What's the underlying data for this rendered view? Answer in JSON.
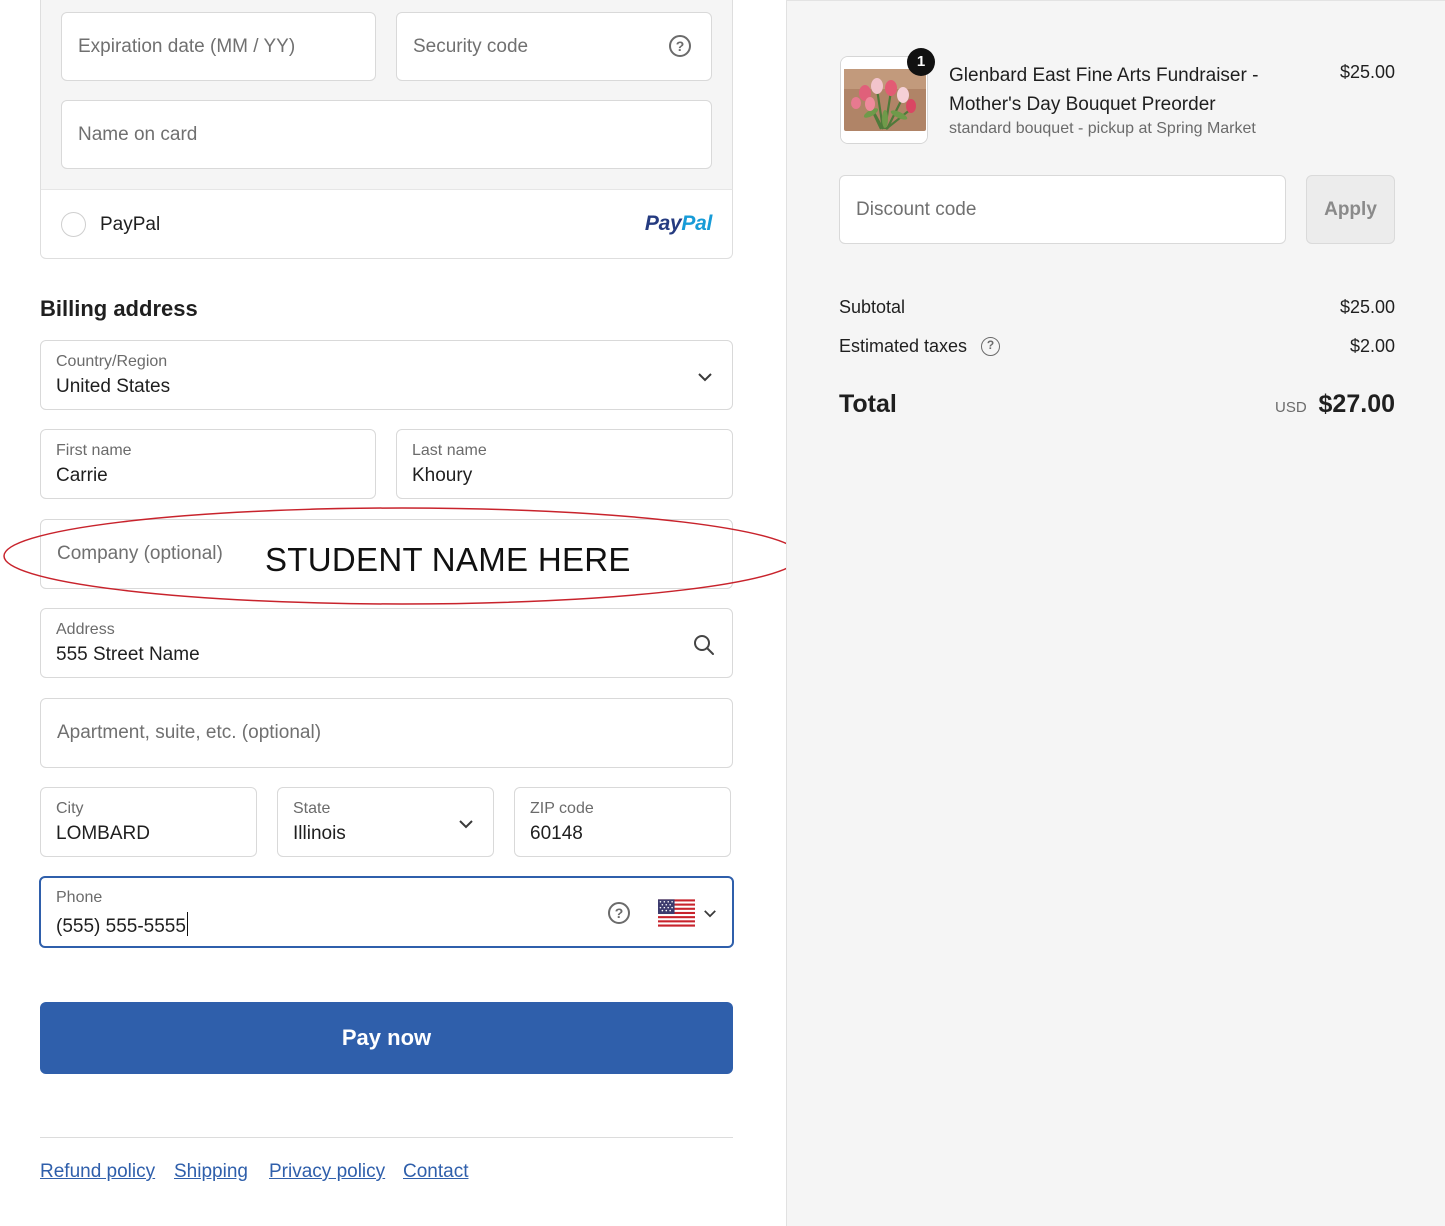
{
  "payment": {
    "expiration_placeholder": "Expiration date (MM / YY)",
    "security_placeholder": "Security code",
    "name_on_card_placeholder": "Name on card",
    "paypal_label": "PayPal",
    "paypal_logo_part1": "Pay",
    "paypal_logo_part2": "Pal"
  },
  "billing": {
    "title": "Billing address",
    "country_label": "Country/Region",
    "country_value": "United States",
    "first_name_label": "First name",
    "first_name_value": "Carrie",
    "last_name_label": "Last name",
    "last_name_value": "Khoury",
    "company_placeholder": "Company (optional)",
    "company_annotation": "STUDENT NAME HERE",
    "address_label": "Address",
    "address_value": "555 Street Name",
    "apartment_placeholder": "Apartment, suite, etc. (optional)",
    "city_label": "City",
    "city_value": "LOMBARD",
    "state_label": "State",
    "state_value": "Illinois",
    "zip_label": "ZIP code",
    "zip_value": "60148",
    "phone_label": "Phone",
    "phone_value": "(555) 555-5555"
  },
  "actions": {
    "pay_now": "Pay now"
  },
  "footer": {
    "links": [
      "Refund policy",
      "Shipping",
      "Privacy policy",
      "Contact"
    ]
  },
  "summary": {
    "item_quantity": "1",
    "item_title": "Glenbard East Fine Arts Fundraiser - Mother's Day Bouquet Preorder",
    "item_variant": "standard bouquet - pickup at Spring Market",
    "item_price": "$25.00",
    "discount_placeholder": "Discount code",
    "apply_label": "Apply",
    "subtotal_label": "Subtotal",
    "subtotal_value": "$25.00",
    "taxes_label": "Estimated taxes",
    "taxes_value": "$2.00",
    "total_label": "Total",
    "total_currency": "USD",
    "total_value": "$27.00"
  },
  "colors": {
    "primary_button": "#2f5fab",
    "link": "#2f5fab",
    "focus_border": "#2f5fab",
    "annotation_ellipse": "#c8232c",
    "sidebar_bg": "#f5f5f5"
  },
  "icons": [
    "question-circle-icon",
    "chevron-down-icon",
    "search-icon",
    "us-flag-icon",
    "paypal-logo"
  ]
}
